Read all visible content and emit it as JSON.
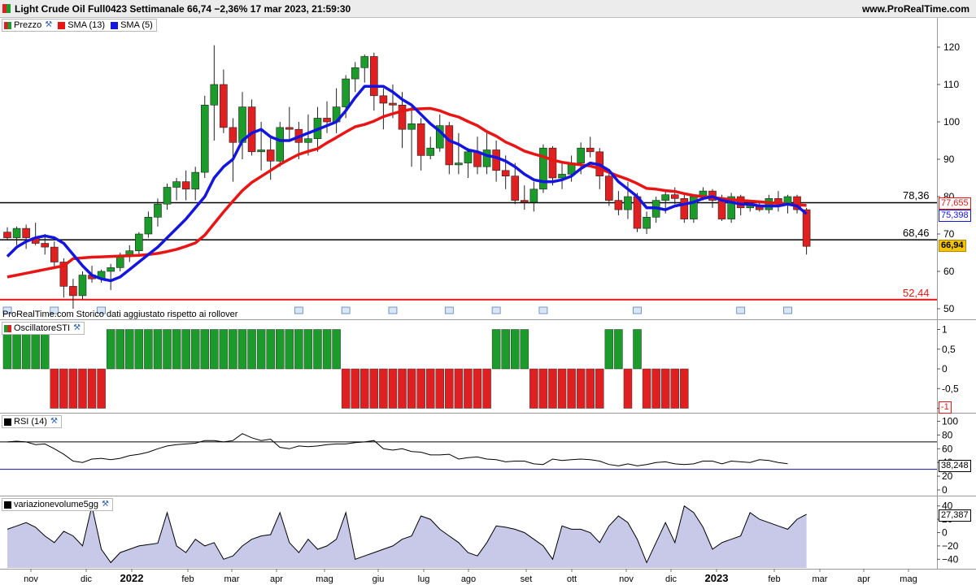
{
  "header": {
    "title": "Light Crude Oil Full0423 Settimanale 66,74 −2,36% 17 mar 2023, 21:59:30",
    "site": "www.ProRealTime.com"
  },
  "legend_price": {
    "prezzo": "Prezzo",
    "sma13": "SMA (13)",
    "sma5": "SMA (5)"
  },
  "price_note": "ProRealTime.com  Storico dati aggiustato rispetto ai rollover",
  "panels": {
    "sti": "OscillatoreSTI",
    "rsi": "RSI (14)",
    "vol": "variazionevolume5gg"
  },
  "levels": {
    "l1": "78,36",
    "l2": "68,46",
    "l3": "52,44"
  },
  "tags": {
    "sma13": "77,655",
    "sma5": "75,398",
    "last": "66,94",
    "sti": "-1",
    "rsi": "38,248",
    "vol": "27,387"
  },
  "colors": {
    "up": "#1a9b2a",
    "down": "#e02020",
    "sma13": "#e81515",
    "sma5": "#1515e0",
    "last_tag_bg": "#f5c400",
    "volume_fill": "#c8c8e8"
  },
  "x_axis_labels": [
    "nov",
    "dic",
    "2022",
    "feb",
    "mar",
    "apr",
    "mag",
    "giu",
    "lug",
    "ago",
    "set",
    "ott",
    "nov",
    "dic",
    "2023",
    "feb",
    "mar",
    "apr",
    "mag"
  ],
  "chart_data": [
    {
      "type": "candlestick",
      "title": "Light Crude Oil Full0423 Settimanale",
      "timeframe": "weekly",
      "ylim": [
        47,
        125
      ],
      "yticks": [
        50,
        60,
        70,
        80,
        90,
        100,
        110,
        120
      ],
      "horizontal_lines": [
        78.36,
        68.46,
        52.44
      ],
      "grid": false,
      "candles": [
        [
          70.5,
          71.8,
          68.5,
          69.0
        ],
        [
          69.0,
          72.0,
          67.0,
          71.5
        ],
        [
          71.5,
          72.5,
          66.0,
          69.0
        ],
        [
          69.0,
          73.0,
          67.0,
          67.5
        ],
        [
          67.5,
          70.0,
          64.5,
          66.5
        ],
        [
          66.5,
          68.0,
          61.0,
          62.5
        ],
        [
          62.5,
          63.5,
          53.0,
          56.0
        ],
        [
          56.0,
          58.0,
          50.0,
          53.5
        ],
        [
          53.5,
          60.0,
          52.5,
          59.0
        ],
        [
          59.0,
          61.5,
          57.0,
          58.0
        ],
        [
          58.0,
          60.5,
          57.0,
          60.0
        ],
        [
          60.0,
          62.0,
          55.0,
          61.0
        ],
        [
          61.0,
          65.0,
          60.0,
          64.0
        ],
        [
          64.0,
          67.0,
          62.5,
          65.5
        ],
        [
          65.5,
          70.5,
          64.5,
          70.0
        ],
        [
          70.0,
          76.0,
          69.0,
          74.5
        ],
        [
          74.5,
          79.5,
          72.0,
          78.0
        ],
        [
          78.0,
          83.5,
          76.5,
          82.5
        ],
        [
          82.5,
          85.0,
          79.0,
          84.0
        ],
        [
          84.0,
          87.0,
          79.0,
          82.0
        ],
        [
          82.0,
          88.0,
          79.0,
          86.5
        ],
        [
          86.5,
          107.0,
          85.0,
          104.5
        ],
        [
          104.5,
          120.5,
          95.0,
          110.0
        ],
        [
          110.0,
          114.0,
          97.0,
          98.5
        ],
        [
          98.5,
          101.0,
          84.0,
          94.5
        ],
        [
          94.5,
          108.0,
          90.0,
          104.0
        ],
        [
          104.0,
          106.0,
          91.0,
          92.0
        ],
        [
          92.0,
          100.0,
          87.0,
          92.5
        ],
        [
          92.5,
          96.0,
          84.5,
          89.5
        ],
        [
          89.5,
          100.0,
          88.0,
          98.5
        ],
        [
          98.5,
          104.0,
          95.0,
          98.0
        ],
        [
          98.0,
          100.0,
          90.0,
          94.5
        ],
        [
          94.5,
          102.0,
          91.0,
          95.5
        ],
        [
          95.5,
          104.0,
          92.0,
          101.0
        ],
        [
          101.0,
          105.5,
          97.0,
          100.0
        ],
        [
          100.0,
          109.0,
          97.0,
          104.0
        ],
        [
          104.0,
          112.5,
          101.0,
          111.5
        ],
        [
          111.5,
          116.0,
          108.0,
          114.5
        ],
        [
          114.5,
          118.0,
          110.5,
          117.5
        ],
        [
          117.5,
          118.5,
          103.0,
          107.0
        ],
        [
          107.0,
          109.0,
          98.0,
          105.0
        ],
        [
          105.0,
          110.0,
          101.0,
          104.5
        ],
        [
          104.5,
          108.0,
          93.0,
          98.0
        ],
        [
          98.0,
          104.0,
          88.0,
          99.5
        ],
        [
          99.5,
          101.0,
          87.0,
          91.0
        ],
        [
          91.0,
          96.0,
          90.0,
          93.0
        ],
        [
          93.0,
          102.0,
          92.0,
          99.0
        ],
        [
          99.0,
          100.0,
          86.0,
          88.5
        ],
        [
          88.5,
          97.0,
          86.0,
          89.0
        ],
        [
          89.0,
          93.0,
          85.0,
          92.0
        ],
        [
          92.0,
          96.0,
          86.0,
          88.0
        ],
        [
          88.0,
          97.0,
          86.0,
          92.5
        ],
        [
          92.5,
          95.0,
          84.0,
          87.0
        ],
        [
          87.0,
          91.0,
          82.0,
          85.5
        ],
        [
          85.5,
          89.0,
          78.0,
          79.0
        ],
        [
          79.0,
          83.0,
          76.5,
          78.5
        ],
        [
          78.5,
          84.0,
          76.0,
          82.0
        ],
        [
          82.0,
          94.0,
          81.0,
          93.0
        ],
        [
          93.0,
          93.5,
          83.0,
          85.0
        ],
        [
          85.0,
          89.0,
          82.0,
          86.0
        ],
        [
          86.0,
          91.0,
          84.0,
          89.0
        ],
        [
          89.0,
          94.5,
          86.0,
          93.0
        ],
        [
          93.0,
          96.0,
          90.5,
          92.0
        ],
        [
          92.0,
          93.0,
          82.0,
          85.5
        ],
        [
          85.5,
          87.0,
          77.5,
          79.0
        ],
        [
          79.0,
          81.5,
          75.0,
          76.5
        ],
        [
          76.5,
          84.0,
          74.0,
          80.0
        ],
        [
          80.0,
          81.0,
          70.5,
          71.5
        ],
        [
          71.5,
          76.0,
          70.0,
          74.5
        ],
        [
          74.5,
          80.0,
          73.0,
          79.0
        ],
        [
          79.0,
          81.5,
          75.5,
          80.5
        ],
        [
          80.5,
          82.5,
          78.0,
          79.5
        ],
        [
          79.5,
          81.0,
          73.0,
          74.0
        ],
        [
          74.0,
          80.5,
          73.0,
          80.0
        ],
        [
          80.0,
          82.5,
          79.0,
          81.5
        ],
        [
          81.5,
          82.0,
          77.0,
          79.0
        ],
        [
          79.0,
          80.5,
          73.5,
          74.0
        ],
        [
          74.0,
          81.0,
          73.0,
          80.0
        ],
        [
          80.0,
          80.5,
          75.0,
          77.0
        ],
        [
          77.0,
          79.0,
          76.0,
          77.5
        ],
        [
          77.5,
          79.0,
          76.0,
          76.5
        ],
        [
          76.5,
          80.5,
          75.5,
          79.5
        ],
        [
          79.5,
          81.5,
          76.0,
          78.0
        ],
        [
          78.0,
          80.5,
          75.5,
          80.0
        ],
        [
          80.0,
          80.5,
          75.5,
          76.5
        ],
        [
          76.5,
          77.0,
          64.5,
          66.7
        ]
      ],
      "series": [
        {
          "name": "SMA (13)",
          "values": [
            58.5,
            59.0,
            59.5,
            60.0,
            60.5,
            61.0,
            61.5,
            63.4,
            63.6,
            63.8,
            63.9,
            64.0,
            64.1,
            64.2,
            64.3,
            64.5,
            64.8,
            65.3,
            65.9,
            66.7,
            67.6,
            69.7,
            72.8,
            75.9,
            78.8,
            81.6,
            83.8,
            85.4,
            87.0,
            88.6,
            90.0,
            91.3,
            92.1,
            92.8,
            94.4,
            95.8,
            97.3,
            98.7,
            99.3,
            100.2,
            101.4,
            102.2,
            102.9,
            103.4,
            103.5,
            103.6,
            103.0,
            102.0,
            101.3,
            100.1,
            99.0,
            97.4,
            96.2,
            94.6,
            93.5,
            92.2,
            91.4,
            90.7,
            89.8,
            89.2,
            88.8,
            88.5,
            88.2,
            87.5,
            86.5,
            85.5,
            84.6,
            83.5,
            82.2,
            82.0,
            81.6,
            81.4,
            80.8,
            80.3,
            80.0,
            79.8,
            79.5,
            79.2,
            79.0,
            78.8,
            78.6,
            78.4,
            78.2,
            78.0,
            77.8,
            77.655
          ]
        },
        {
          "name": "SMA (5)",
          "values": [
            64.0,
            66.5,
            68.0,
            69.0,
            69.5,
            69.0,
            67.5,
            64.5,
            61.5,
            59.0,
            58.0,
            57.5,
            58.5,
            60.5,
            62.5,
            64.5,
            66.5,
            69.0,
            71.5,
            74.0,
            77.0,
            80.0,
            85.0,
            88.0,
            90.0,
            95.0,
            97.0,
            98.0,
            96.0,
            95.0,
            95.0,
            96.0,
            97.0,
            98.0,
            99.0,
            100.0,
            103.0,
            106.5,
            109.5,
            109.5,
            109.5,
            108.0,
            106.0,
            104.5,
            102.0,
            99.5,
            97.5,
            95.0,
            94.0,
            92.5,
            92.0,
            91.0,
            90.5,
            89.5,
            88.0,
            86.0,
            84.5,
            84.0,
            84.0,
            84.5,
            85.5,
            87.5,
            89.0,
            88.5,
            87.0,
            84.0,
            82.0,
            80.0,
            77.0,
            77.0,
            76.5,
            77.5,
            78.0,
            78.5,
            79.5,
            80.0,
            79.0,
            78.5,
            78.0,
            78.0,
            77.5,
            77.5,
            77.5,
            78.0,
            77.5,
            75.398
          ]
        }
      ]
    },
    {
      "type": "bar",
      "title": "OscillatoreSTI",
      "ylim": [
        -1.1,
        1.1
      ],
      "yticks": [
        -1,
        -0.5,
        0,
        0.5,
        1
      ],
      "values": [
        1,
        1,
        1,
        1,
        1,
        -1,
        -1,
        -1,
        -1,
        -1,
        -1,
        1,
        1,
        1,
        1,
        1,
        1,
        1,
        1,
        1,
        1,
        1,
        1,
        1,
        1,
        1,
        1,
        1,
        1,
        1,
        1,
        1,
        1,
        1,
        1,
        1,
        -1,
        -1,
        -1,
        -1,
        -1,
        -1,
        -1,
        -1,
        -1,
        -1,
        -1,
        -1,
        -1,
        -1,
        -1,
        -1,
        1,
        1,
        1,
        1,
        -1,
        -1,
        -1,
        -1,
        -1,
        -1,
        -1,
        -1,
        1,
        1,
        -1,
        1,
        -1,
        -1,
        -1,
        -1,
        -1
      ]
    },
    {
      "type": "line",
      "title": "RSI (14)",
      "ylim": [
        0,
        100
      ],
      "yticks": [
        0,
        20,
        40,
        60,
        80,
        100
      ],
      "horizontal_lines": [
        70,
        30
      ],
      "values": [
        70,
        71,
        70,
        66,
        67,
        60,
        52,
        42,
        40,
        45,
        46,
        44,
        46,
        50,
        52,
        55,
        60,
        64,
        66,
        67,
        68,
        72,
        72,
        70,
        72,
        82,
        76,
        72,
        74,
        62,
        60,
        64,
        63,
        64,
        66,
        67,
        67,
        69,
        70,
        72,
        60,
        58,
        60,
        56,
        55,
        51,
        51,
        52,
        45,
        47,
        48,
        45,
        44,
        41,
        42,
        42,
        38,
        37,
        45,
        43,
        44,
        45,
        44,
        42,
        37,
        35,
        38,
        35,
        37,
        40,
        41,
        38,
        37,
        38,
        42,
        42,
        38,
        42,
        41,
        40,
        44,
        43,
        40,
        38.248
      ]
    },
    {
      "type": "area",
      "title": "variazionevolume5gg",
      "ylim": [
        -55,
        50
      ],
      "yticks": [
        -40,
        -20,
        0,
        20,
        40
      ],
      "values": [
        5,
        10,
        15,
        8,
        -5,
        -15,
        2,
        -5,
        -20,
        40,
        -25,
        -45,
        -30,
        -25,
        -20,
        -18,
        -16,
        30,
        -20,
        -30,
        -10,
        -20,
        -15,
        -40,
        -35,
        -20,
        -10,
        -5,
        -3,
        30,
        -15,
        -30,
        -10,
        -25,
        -20,
        -10,
        30,
        -40,
        -35,
        -30,
        -25,
        -20,
        -10,
        -5,
        25,
        20,
        5,
        -5,
        -15,
        -30,
        -35,
        -15,
        10,
        8,
        5,
        0,
        -10,
        -20,
        -40,
        10,
        5,
        5,
        0,
        -15,
        10,
        25,
        15,
        -10,
        -45,
        -15,
        15,
        -15,
        40,
        30,
        8,
        -25,
        -15,
        -10,
        -5,
        30,
        20,
        15,
        10,
        5,
        20,
        27.387
      ]
    }
  ]
}
